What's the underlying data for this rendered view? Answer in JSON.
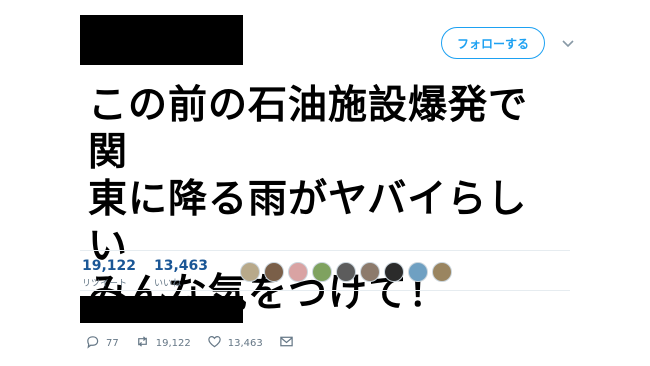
{
  "header": {
    "follow_label": "フォローする"
  },
  "tweet": {
    "text": "この前の石油施設爆発で関\n東に降る雨がヤバイらしい\nみんな気をつけて！"
  },
  "stats": {
    "retweets": {
      "count": "19,122",
      "label": "リツイート"
    },
    "likes": {
      "count": "13,463",
      "label": "いいね"
    }
  },
  "liker_avatars": [
    {
      "color": "#b8a98a"
    },
    {
      "color": "#7a5f48"
    },
    {
      "color": "#d9a3a3"
    },
    {
      "color": "#7fa25f"
    },
    {
      "color": "#5c5c5c"
    },
    {
      "color": "#8c7a6b"
    },
    {
      "color": "#2b2b2b"
    },
    {
      "color": "#6fa0c2"
    },
    {
      "color": "#9a8560"
    }
  ],
  "actions": {
    "reply": {
      "count": "77",
      "icon": "reply-icon"
    },
    "retweet": {
      "count": "19,122",
      "icon": "retweet-icon"
    },
    "like": {
      "count": "13,463",
      "icon": "heart-icon"
    },
    "dm": {
      "icon": "envelope-icon"
    }
  },
  "colors": {
    "accent": "#1da1f2",
    "stat_number": "#1b5796",
    "muted": "#657786"
  }
}
